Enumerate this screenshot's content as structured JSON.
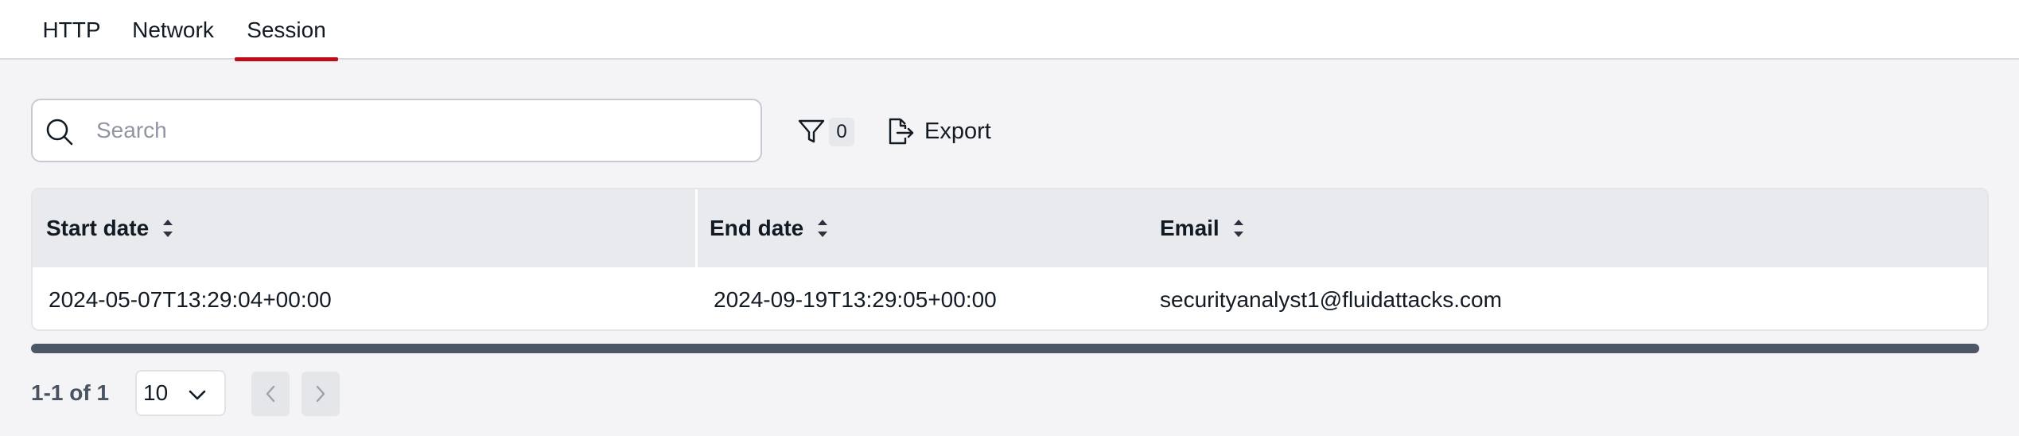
{
  "tabs": [
    {
      "label": "HTTP"
    },
    {
      "label": "Network"
    },
    {
      "label": "Session",
      "active": true
    }
  ],
  "toolbar": {
    "search_placeholder": "Search",
    "filter_count": "0",
    "export_label": "Export"
  },
  "table": {
    "columns": [
      "Start date",
      "End date",
      "Email"
    ],
    "rows": [
      {
        "start_date": "2024-05-07T13:29:04+00:00",
        "end_date": "2024-09-19T13:29:05+00:00",
        "email": "securityanalyst1@fluidattacks.com"
      }
    ]
  },
  "pagination": {
    "info": "1-1 of 1",
    "page_size": "10"
  },
  "colors": {
    "accent": "#bf0b1a",
    "background": "#f4f4f6",
    "header": "#e9eaee"
  }
}
